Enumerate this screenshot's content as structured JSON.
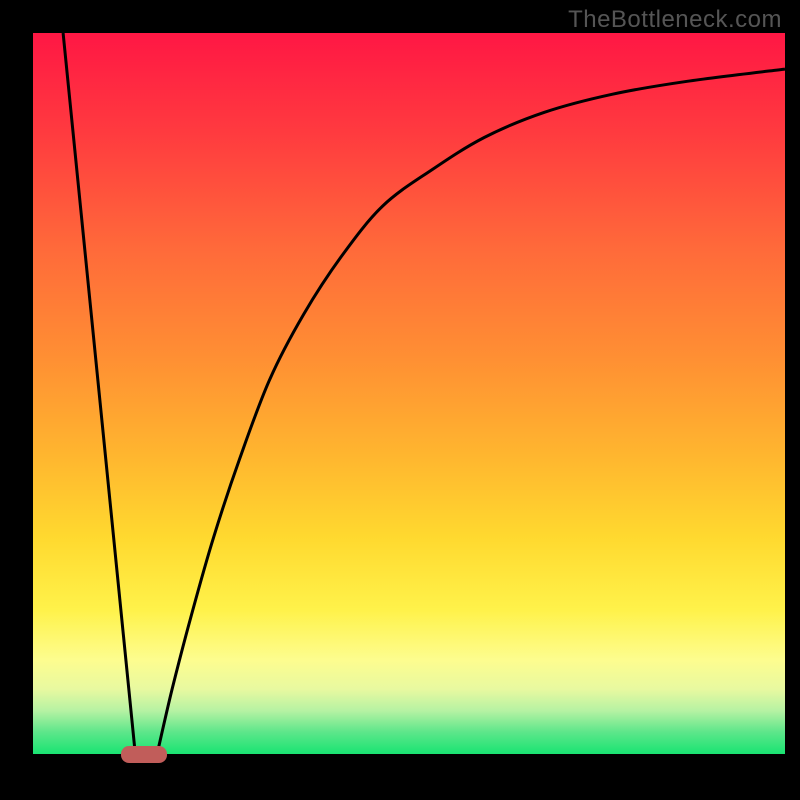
{
  "watermark": "TheBottleneck.com",
  "chart_data": {
    "type": "line",
    "title": "",
    "xlabel": "",
    "ylabel": "",
    "xlim": [
      0,
      100
    ],
    "ylim": [
      0,
      100
    ],
    "background_gradient": {
      "stops": [
        {
          "offset": 0,
          "color": "#ff1744"
        },
        {
          "offset": 14,
          "color": "#ff3b3f"
        },
        {
          "offset": 30,
          "color": "#ff6a3a"
        },
        {
          "offset": 45,
          "color": "#ff8f33"
        },
        {
          "offset": 58,
          "color": "#ffb42f"
        },
        {
          "offset": 70,
          "color": "#ffd92f"
        },
        {
          "offset": 80,
          "color": "#fff24a"
        },
        {
          "offset": 87,
          "color": "#fdfd8f"
        },
        {
          "offset": 91,
          "color": "#e8f9a0"
        },
        {
          "offset": 94,
          "color": "#b6f2a3"
        },
        {
          "offset": 97,
          "color": "#5ce68a"
        },
        {
          "offset": 100,
          "color": "#19e472"
        }
      ]
    },
    "series": [
      {
        "name": "left-line",
        "type": "line",
        "points": [
          {
            "x": 4.0,
            "y": 100
          },
          {
            "x": 13.6,
            "y": 0
          }
        ]
      },
      {
        "name": "right-curve",
        "type": "line",
        "points": [
          {
            "x": 16.5,
            "y": 0
          },
          {
            "x": 18.5,
            "y": 9
          },
          {
            "x": 21.0,
            "y": 19
          },
          {
            "x": 24.0,
            "y": 30
          },
          {
            "x": 27.5,
            "y": 41
          },
          {
            "x": 31.5,
            "y": 52
          },
          {
            "x": 36.0,
            "y": 61
          },
          {
            "x": 41.0,
            "y": 69
          },
          {
            "x": 46.5,
            "y": 76
          },
          {
            "x": 53.0,
            "y": 81
          },
          {
            "x": 60.0,
            "y": 85.5
          },
          {
            "x": 68.0,
            "y": 89
          },
          {
            "x": 77.0,
            "y": 91.5
          },
          {
            "x": 87.0,
            "y": 93.3
          },
          {
            "x": 100.0,
            "y": 95
          }
        ]
      }
    ],
    "marker": {
      "x": 14.8,
      "width_pct": 6.1,
      "color": "#c15d5a"
    }
  }
}
